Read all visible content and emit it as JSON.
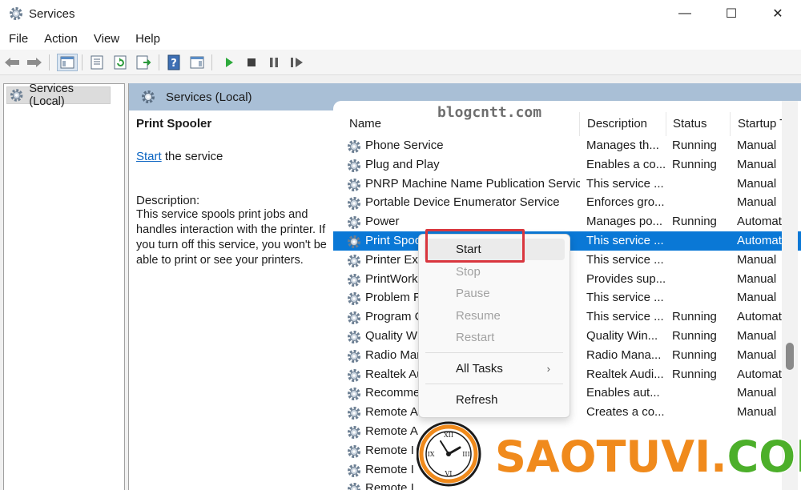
{
  "window": {
    "title": "Services",
    "min_glyph": "—",
    "max_glyph": "☐",
    "close_glyph": "✕"
  },
  "menu": [
    "File",
    "Action",
    "View",
    "Help"
  ],
  "tree": {
    "item": "Services (Local)"
  },
  "pane_header": "Services (Local)",
  "detail": {
    "service_name": "Print Spooler",
    "start_link": "Start",
    "start_suffix": " the service",
    "description_label": "Description:",
    "description": "This service spools print jobs and handles interaction with the printer. If you turn off this service, you won't be able to print or see your printers."
  },
  "columns": [
    "Name",
    "Description",
    "Status",
    "Startup T"
  ],
  "rows": [
    {
      "name": "Phone Service",
      "desc": "Manages th...",
      "status": "Running",
      "startup": "Manual"
    },
    {
      "name": "Plug and Play",
      "desc": "Enables a co...",
      "status": "Running",
      "startup": "Manual"
    },
    {
      "name": "PNRP Machine Name Publication Service",
      "desc": "This service ...",
      "status": "",
      "startup": "Manual"
    },
    {
      "name": "Portable Device Enumerator Service",
      "desc": "Enforces gro...",
      "status": "",
      "startup": "Manual"
    },
    {
      "name": "Power",
      "desc": "Manages po...",
      "status": "Running",
      "startup": "Automat"
    },
    {
      "name": "Print Spooler",
      "desc": "This service ...",
      "status": "",
      "startup": "Automat",
      "selected": true
    },
    {
      "name": "Printer Ext",
      "desc": "This service ...",
      "status": "",
      "startup": "Manual"
    },
    {
      "name": "PrintWork",
      "desc": "Provides sup...",
      "status": "",
      "startup": "Manual"
    },
    {
      "name": "Problem R",
      "desc": "This service ...",
      "status": "",
      "startup": "Manual"
    },
    {
      "name": "Program C",
      "desc": "This service ...",
      "status": "Running",
      "startup": "Automat"
    },
    {
      "name": "Quality W",
      "desc": "Quality Win...",
      "status": "Running",
      "startup": "Manual"
    },
    {
      "name": "Radio Man",
      "desc": "Radio Mana...",
      "status": "Running",
      "startup": "Manual"
    },
    {
      "name": "Realtek Au",
      "desc": "Realtek Audi...",
      "status": "Running",
      "startup": "Automat"
    },
    {
      "name": "Recomme",
      "desc": "Enables aut...",
      "status": "",
      "startup": "Manual"
    },
    {
      "name": "Remote Ac",
      "desc": "Creates a co...",
      "status": "",
      "startup": "Manual"
    },
    {
      "name": "Remote A",
      "desc": "",
      "status": "",
      "startup": ""
    },
    {
      "name": "Remote I",
      "desc": "",
      "status": "",
      "startup": ""
    },
    {
      "name": "Remote I",
      "desc": "",
      "status": "",
      "startup": ""
    },
    {
      "name": "Remote I",
      "desc": "",
      "status": "",
      "startup": ""
    }
  ],
  "context_menu": {
    "start": "Start",
    "stop": "Stop",
    "pause": "Pause",
    "resume": "Resume",
    "restart": "Restart",
    "all_tasks": "All Tasks",
    "all_tasks_chevron": "›",
    "refresh": "Refresh"
  },
  "watermarks": {
    "blog": "blogcntt.com",
    "logo": "SAOTUVI.COM"
  },
  "colors": {
    "selection": "#0a78d6",
    "header": "#a9bfd6",
    "link": "#0a64c2",
    "highlight_box": "#d9363e",
    "logo_orange": "#f08a1c",
    "logo_green": "#4caf2a"
  }
}
